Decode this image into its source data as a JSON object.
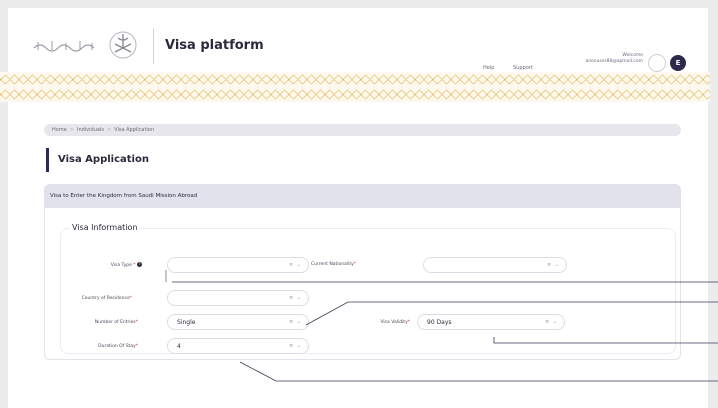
{
  "header": {
    "app_title": "Visa platform",
    "nav": {
      "help": "Help",
      "support": "Support"
    },
    "user": {
      "welcome": "Welcome",
      "email": "anonuser88@apmail.com",
      "avatar_initial": "E"
    },
    "logo_icon": "saudi-emblem-icon"
  },
  "breadcrumb": {
    "items": [
      "Home",
      "Individuals",
      "Visa Application"
    ],
    "separator": ">"
  },
  "page_title": "Visa Application",
  "section_banner": "Visa to Enter the Kingdom from Saudi Mission Abroad",
  "form": {
    "legend": "Visa Information",
    "fields": {
      "visa_type": {
        "label": "Visa Type",
        "value": ""
      },
      "current_nationality": {
        "label": "Current Nationality",
        "value": ""
      },
      "country_of_residence": {
        "label": "Country of Residence",
        "value": ""
      },
      "number_of_entries": {
        "label": "Number of Entries",
        "value": "Single"
      },
      "visa_validity": {
        "label": "Visa Validity",
        "value": "90 Days"
      },
      "duration_of_stay": {
        "label": "Duration Of Stay",
        "value": "4"
      }
    },
    "select_controls": "× ⌄",
    "required_mark": "*"
  },
  "colors": {
    "primary": "#2d2a4e",
    "accent_gold": "#e8c77a",
    "banner_bg": "#e2e2ec"
  }
}
